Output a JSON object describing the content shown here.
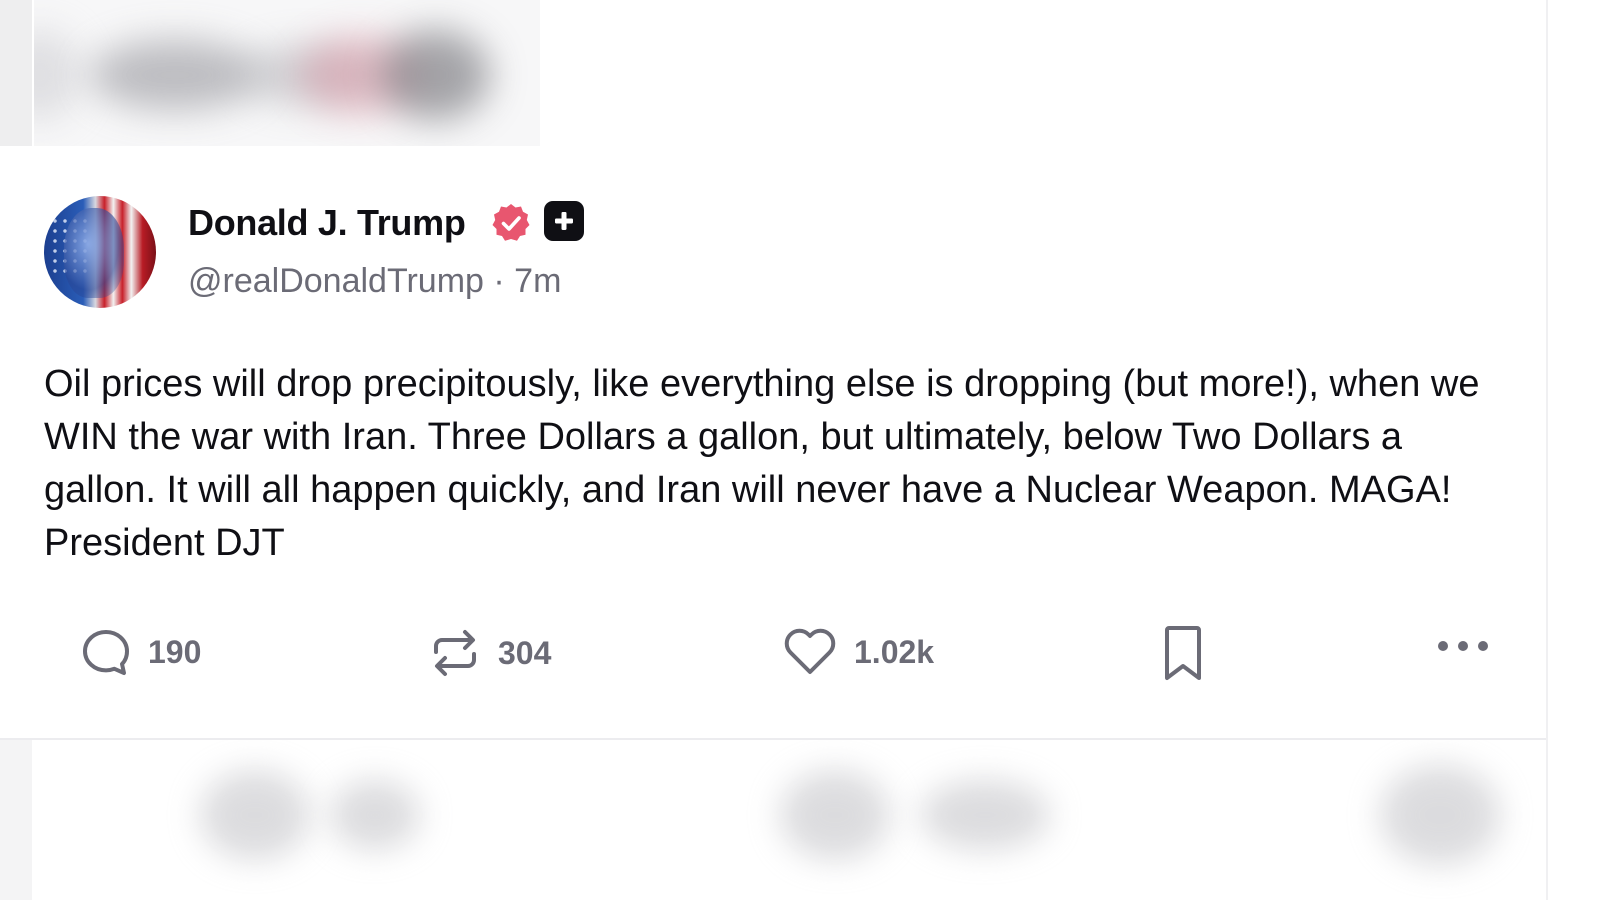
{
  "post": {
    "author_name": "Donald J. Trump",
    "handle": "@realDonaldTrump",
    "separator": "·",
    "time_ago": "7m",
    "text": "Oil prices will drop precipitously, like everything else is dropping (but more!), when we WIN the war with Iran. Three Dollars a gallon, but ultimately, below Two Dollars a gallon. It will all happen quickly, and Iran will never have a Nuclear Weapon. MAGA! President DJT",
    "badges": {
      "verified_icon": "verified-check-icon",
      "verified_color": "#e8566f",
      "plus_icon": "plus-square-icon",
      "plus_color": "#0f0f14"
    }
  },
  "actions": {
    "reply": {
      "icon": "comment-icon",
      "count": "190"
    },
    "retruth": {
      "icon": "repost-icon",
      "count": "304"
    },
    "like": {
      "icon": "heart-icon",
      "count": "1.02k"
    },
    "bookmark": {
      "icon": "bookmark-icon"
    },
    "more": {
      "icon": "more-horizontal-icon"
    }
  },
  "colors": {
    "text_primary": "#0f0f14",
    "text_secondary": "#6b6b76",
    "divider": "#ececef"
  }
}
